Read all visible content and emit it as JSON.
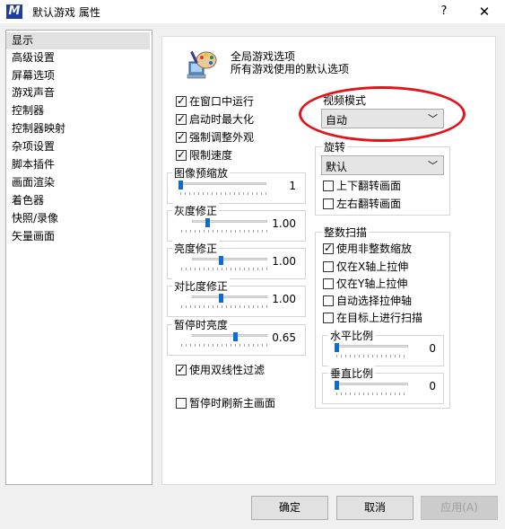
{
  "window": {
    "title": "默认游戏 属性",
    "help_glyph": "?",
    "close_glyph": "✕",
    "app_icon": "mame-m-icon"
  },
  "nav": {
    "items": [
      "显示",
      "高级设置",
      "屏幕选项",
      "游戏声音",
      "控制器",
      "控制器映射",
      "杂项设置",
      "脚本插件",
      "画面渲染",
      "着色器",
      "快照/录像",
      "矢量画面"
    ],
    "selected_index": 0
  },
  "header": {
    "line1": "全局游戏选项",
    "line2": "所有游戏使用的默认选项",
    "icon": "palette-computer-icon"
  },
  "checks": {
    "windowed": {
      "label": "在窗口中运行",
      "checked": true
    },
    "maximize": {
      "label": "启动时最大化",
      "checked": true
    },
    "keepaspect": {
      "label": "强制调整外观",
      "checked": true
    },
    "throttle": {
      "label": "限制速度",
      "checked": true
    },
    "bilinear": {
      "label": "使用双线性过滤",
      "checked": true
    },
    "refresh_pause": {
      "label": "暂停时刷新主画面",
      "checked": false
    }
  },
  "sliders": {
    "prescale": {
      "label": "图像预缩放",
      "value": "1"
    },
    "gamma": {
      "label": "灰度修正",
      "value": "1.00"
    },
    "brightness": {
      "label": "亮度修正",
      "value": "1.00"
    },
    "contrast": {
      "label": "对比度修正",
      "value": "1.00"
    },
    "pause_brightness": {
      "label": "暂停时亮度",
      "value": "0.65"
    }
  },
  "video_mode": {
    "label": "视频模式",
    "value": "自动"
  },
  "rotation": {
    "label": "旋转",
    "value": "默认",
    "flip_y": {
      "label": "上下翻转画面",
      "checked": false
    },
    "flip_x": {
      "label": "左右翻转画面",
      "checked": false
    }
  },
  "intscale": {
    "label": "整数扫描",
    "nonint": {
      "label": "使用非整数缩放",
      "checked": true
    },
    "stretch_x": {
      "label": "仅在X轴上拉伸",
      "checked": false
    },
    "stretch_y": {
      "label": "仅在Y轴上拉伸",
      "checked": false
    },
    "auto_axis": {
      "label": "自动选择拉伸轴",
      "checked": false
    },
    "on_target": {
      "label": "在目标上进行扫描",
      "checked": false
    },
    "h_ratio": {
      "label": "水平比例",
      "value": "0"
    },
    "v_ratio": {
      "label": "垂直比例",
      "value": "0"
    }
  },
  "buttons": {
    "ok": "确定",
    "cancel": "取消",
    "apply": "应用(A)"
  },
  "colors": {
    "accent": "#0d6bd6",
    "highlight_ring": "#e2141b",
    "selected_bg": "#e1e1e1"
  }
}
